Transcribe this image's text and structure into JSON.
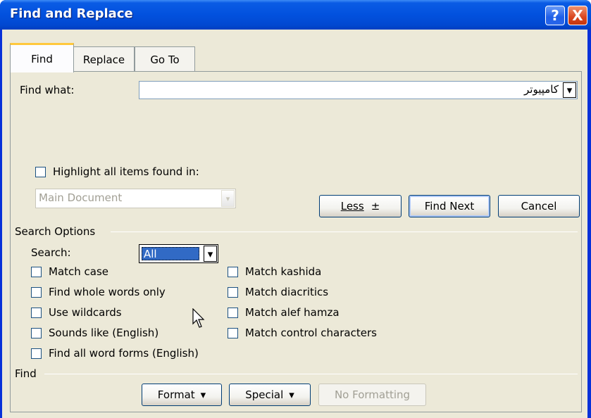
{
  "window": {
    "title": "Find and Replace",
    "help_glyph": "?",
    "close_glyph": "X"
  },
  "tabs": [
    {
      "label": "Find",
      "accel": "d",
      "active": true
    },
    {
      "label": "Replace",
      "accel": "p",
      "active": false
    },
    {
      "label": "Go To",
      "accel": "G",
      "active": false
    }
  ],
  "find_what": {
    "label": "Find what:",
    "value": "کامپیوتر"
  },
  "highlight": {
    "label": "Highlight all items found in:",
    "checked": false,
    "select_value": "Main Document"
  },
  "buttons": {
    "less": "Less",
    "less_glyph": "±",
    "find_next": "Find Next",
    "cancel": "Cancel",
    "format": "Format",
    "special": "Special",
    "no_formatting": "No Formatting",
    "dropdown_glyph": "▾"
  },
  "search_options": {
    "heading": "Search Options",
    "search_label": "Search:",
    "search_value": "All",
    "left_options": [
      {
        "label": "Match case",
        "checked": false
      },
      {
        "label": "Find whole words only",
        "checked": false
      },
      {
        "label": "Use wildcards",
        "checked": false
      },
      {
        "label": "Sounds like (English)",
        "checked": false
      },
      {
        "label": "Find all word forms (English)",
        "checked": false
      }
    ],
    "right_options": [
      {
        "label": "Match kashida",
        "checked": false
      },
      {
        "label": "Match diacritics",
        "checked": false
      },
      {
        "label": "Match alef hamza",
        "checked": false
      },
      {
        "label": "Match control characters",
        "checked": false
      }
    ]
  },
  "find_section": {
    "heading": "Find"
  },
  "colors": {
    "titlebar": "#0251de",
    "dialog_bg": "#ece9d8",
    "selection": "#316ac5"
  }
}
